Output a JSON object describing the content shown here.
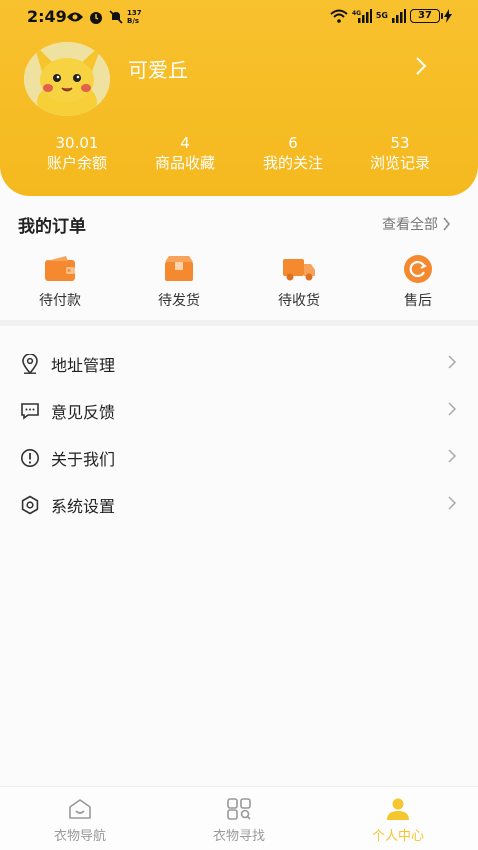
{
  "status_bar": {
    "time": "2:49",
    "speed_value": "137",
    "speed_unit": "B/s",
    "network_label": "5G",
    "battery": "37"
  },
  "profile": {
    "username": "可爱丘"
  },
  "stats": [
    {
      "value": "30.01",
      "label": "账户余额"
    },
    {
      "value": "4",
      "label": "商品收藏"
    },
    {
      "value": "6",
      "label": "我的关注"
    },
    {
      "value": "53",
      "label": "浏览记录"
    }
  ],
  "orders": {
    "title": "我的订单",
    "view_all": "查看全部",
    "items": [
      {
        "label": "待付款",
        "icon": "wallet-icon"
      },
      {
        "label": "待发货",
        "icon": "box-icon"
      },
      {
        "label": "待收货",
        "icon": "truck-icon"
      },
      {
        "label": "售后",
        "icon": "refresh-icon"
      }
    ]
  },
  "menu": [
    {
      "label": "地址管理",
      "icon": "location-pin-icon"
    },
    {
      "label": "意见反馈",
      "icon": "feedback-icon"
    },
    {
      "label": "关于我们",
      "icon": "info-icon"
    },
    {
      "label": "系统设置",
      "icon": "settings-icon"
    }
  ],
  "tabbar": [
    {
      "label": "衣物导航",
      "icon": "home-icon",
      "active": false
    },
    {
      "label": "衣物寻找",
      "icon": "grid-search-icon",
      "active": false
    },
    {
      "label": "个人中心",
      "icon": "person-icon",
      "active": true
    }
  ],
  "colors": {
    "accent": "#f6c62f",
    "header": "#f7be25",
    "order_icon": "#f4892f"
  }
}
